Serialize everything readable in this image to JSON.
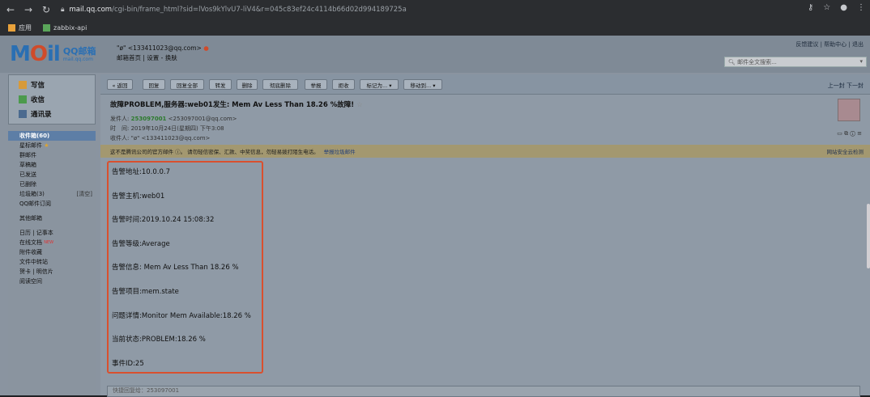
{
  "browser": {
    "url_host": "mail.qq.com",
    "url_path": "/cgi-bin/frame_html?sid=lVos9kYlvU7-liV4&r=045c83ef24c4114b66d02d994189725a",
    "bookmarks": [
      "应用",
      "zabbix-api"
    ]
  },
  "header": {
    "logo_text": "QQ邮箱",
    "logo_sub": "mail.qq.com",
    "user_line": "\"ø\" <133411023@qq.com>",
    "user_links": "邮箱首页 | 设置 - 换肤",
    "top_links": "反馈建议 | 帮助中心 | 退出",
    "search_placeholder": "邮件全文搜索..."
  },
  "sidebar": {
    "top_buttons": [
      "写信",
      "收信",
      "通讯录"
    ],
    "items": [
      {
        "label": "收件箱(60)",
        "active": true
      },
      {
        "label": "星标邮件"
      },
      {
        "label": "群邮件"
      },
      {
        "label": "草稿箱"
      },
      {
        "label": "已发送"
      },
      {
        "label": "已删除"
      },
      {
        "label": "垃圾箱(3)",
        "extra": "[清空]"
      },
      {
        "label": "QQ邮件订阅"
      },
      {
        "label": "其他邮箱"
      },
      {
        "label": "日历 | 记事本"
      },
      {
        "label": "在线文档",
        "badge": "NEW"
      },
      {
        "label": "附件收藏"
      },
      {
        "label": "文件中转站"
      },
      {
        "label": "贺卡 | 明信片"
      },
      {
        "label": "阅读空间"
      }
    ]
  },
  "toolbar": {
    "buttons": [
      "« 返回",
      "回复",
      "回复全部",
      "转发",
      "删除",
      "彻底删除",
      "举报",
      "拒收",
      "标记为... ▾",
      "移动到... ▾"
    ],
    "pager": "上一封 下一封"
  },
  "mail": {
    "subject": "故障PROBLEM,服务器:web01发生: Mem Av Less Than 18.26 %故障!",
    "from_label": "发件人:",
    "from_name": "253097001",
    "from_addr": "<253097001@qq.com>",
    "time_label": "时　间:",
    "time": "2019年10月24日(星期四) 下午3:08",
    "to_label": "收件人:",
    "to": "\"ø\" <133411023@qq.com>",
    "warning": "这不是腾讯公司的官方邮件 ⓘ。 请勿轻信密保、汇款、中奖信息，勿轻易拨打陌生电话。",
    "warning_report": "举报垃圾邮件",
    "warning_right": "网站安全云检测",
    "body_lines": [
      "告警地址:10.0.0.7",
      "告警主机:web01",
      "告警时间:2019.10.24 15:08:32",
      "告警等级:Average",
      "告警信息: Mem Av Less Than 18.26 %",
      "告警项目:mem.state",
      "问题详情:Monitor Mem Available:18.26 %",
      "当前状态:PROBLEM:18.26 %",
      "事件ID:25"
    ],
    "reply_placeholder": "快捷回复给：253097001"
  }
}
